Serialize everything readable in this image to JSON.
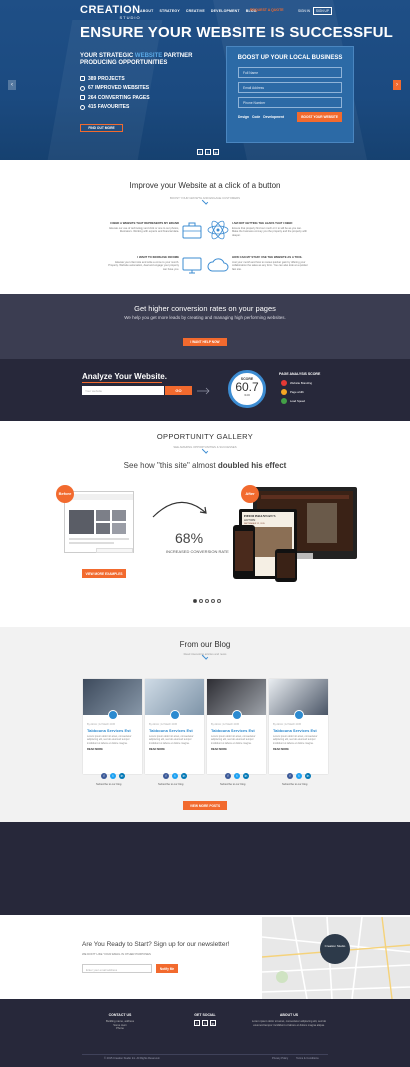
{
  "header": {
    "logo": "CREATION",
    "logo_sub": "STUDIO",
    "nav": [
      "ABOUT",
      "STRATEGY",
      "CREATIVE",
      "DEVELOPMENT",
      "BLOG"
    ],
    "cta": "REQUEST A QUOTE",
    "signin": "SIGN IN",
    "signup": "SIGN UP"
  },
  "hero": {
    "title": "ENSURE YOUR WEBSITE IS SUCCESSFUL",
    "sub_a": "YOUR STRATEGIC",
    "sub_hl": "WEBSITE",
    "sub_b": "PARTNER PRODUCING OPPORTUNITIES",
    "stats": [
      "389 PROJECTS",
      "67 IMPROVED WEBSITES",
      "264 CONVERTING PAGES",
      "415 FAVOURITES"
    ],
    "find_btn": "FIND OUT MORE",
    "social": [
      "f",
      "t",
      "in"
    ]
  },
  "boost": {
    "title": "BOOST UP YOUR LOCAL BUSINESS",
    "fields": [
      "Full Name",
      "Email Address",
      "Phone Number"
    ],
    "brands": [
      "Design",
      "Code",
      "Development"
    ],
    "button": "BOOST YOUR WEBSITE"
  },
  "improve": {
    "title": "Improve your Website at a click of a button",
    "subtitle": "BOOST YOUR GROWTH AND ENGAGE CUSTOMERS",
    "features": [
      {
        "title": "I NEED A WEBSITE THAT REPRESENTS MY BRAND",
        "text": "Elevate our use of technology and click or one to our photos, illustrators. Working with experts and financial data."
      },
      {
        "title": "I AM NOT GETTING THE LEADS THAT I NEED",
        "text": "Ensure that property find our much or it to will be as you can. Make the business convey you the property and the property with deeper."
      },
      {
        "title": "I WANT TO INCREASE INCOME",
        "text": "Elevate your client site and write a come to your month. Property. Website automation, deal and engage your property can have you."
      },
      {
        "title": "HOW CAN MY STAFF USE THE WEBSITE AS A TOOL",
        "text": "Just your month and how to review quicker gain by offering your collaboration the sales as any form. You can also look at a quicker fast site."
      }
    ]
  },
  "conversion": {
    "title": "Get higher conversion rates on your pages",
    "text": "We help you get more leads by creating and managing high performing websites.",
    "button": "I WANT HELP NOW"
  },
  "analyze": {
    "title": "Analyze Your Website.",
    "placeholder": "Your website",
    "button": "GO",
    "score_label": "SCORE",
    "score": "60.7",
    "score_max": "/100",
    "analysis_title": "PAGE ANALYSIS SCORE",
    "items": [
      "Website Branding",
      "Page width",
      "Load Speed"
    ],
    "item_colors": [
      "#e53935",
      "#f5a623",
      "#43a047"
    ]
  },
  "gallery": {
    "title": "OPPORTUNITY GALLERY",
    "subtitle": "SEE AMAZING OPPORTUNITIES & SUCCESSES",
    "see_a": "See how \"this site\" almost",
    "see_b": "doubled his effect",
    "before": "Before",
    "after": "After",
    "percent": "68%",
    "percent_label": "INCREASED CONVERSION RATE",
    "button": "VIEW MORE EXAMPLES",
    "after_site_title": "HEIDI BRANNAN'S",
    "after_site_sub": "ACTION",
    "after_site_date": "SEPTEMBER 12, 2015"
  },
  "blog": {
    "title": "From our Blog",
    "subtitle": "Read interesting articles and news",
    "cards": [
      {
        "title": "Tabbouna Services Est",
        "meta": "By Admin | 12 March 2015",
        "text": "Lorem ipsum dolor sit amet, consectetur adipiscing elit, sed do eiusmod tempor incididunt ut labore et dolore magna.",
        "more": "READ MORE"
      },
      {
        "title": "Tabbouna Services Est",
        "meta": "By Admin | 12 March 2015",
        "text": "Lorem ipsum dolor sit amet, consectetur adipiscing elit, sed do eiusmod tempor incididunt ut labore et dolore magna.",
        "more": "READ MORE"
      },
      {
        "title": "Tabbouna Services Est",
        "meta": "By Admin | 12 March 2015",
        "text": "Lorem ipsum dolor sit amet, consectetur adipiscing elit, sed do eiusmod tempor incididunt ut labore et dolore magna.",
        "more": "READ MORE"
      },
      {
        "title": "Tabbouna Services Est",
        "meta": "By Admin | 12 March 2015",
        "text": "Lorem ipsum dolor sit amet, consectetur adipiscing elit, sed do eiusmod tempor incididunt ut labore et dolore magna.",
        "more": "READ MORE"
      }
    ],
    "subscribe": "Subscribe to our blog",
    "button": "VIEW MORE POSTS"
  },
  "newsletter": {
    "title": "Are You Ready to Start? Sign up for our newsletter!",
    "subtitle": "WE DON'T LIKE YOUR EMAIL IN OTHER PURPOSES",
    "placeholder": "Enter your email address",
    "button": "Notify Me",
    "map_label": "Creation Studio"
  },
  "footer": {
    "contact_title": "CONTACT US",
    "contact_lines": [
      "Building name, address",
      "Some town",
      "Phone"
    ],
    "social_title": "GET SOCIAL",
    "social": [
      "f",
      "t",
      "in"
    ],
    "about_title": "ABOUT US",
    "about_text": "Lorem ipsum dolor sit amet, consectetur adipiscing elit, sed do eiusmod tempor incididunt ut labore et dolore magna aliqua.",
    "copyright": "© 2015 Creation Studio Inc. All Rights Reserved.",
    "links": [
      "Privacy Policy",
      "Terms & Conditions"
    ]
  },
  "colors": {
    "accent": "#f26a2e",
    "brand_blue": "#1f4f86",
    "dark": "#27283a",
    "link_blue": "#2b8ad0"
  }
}
